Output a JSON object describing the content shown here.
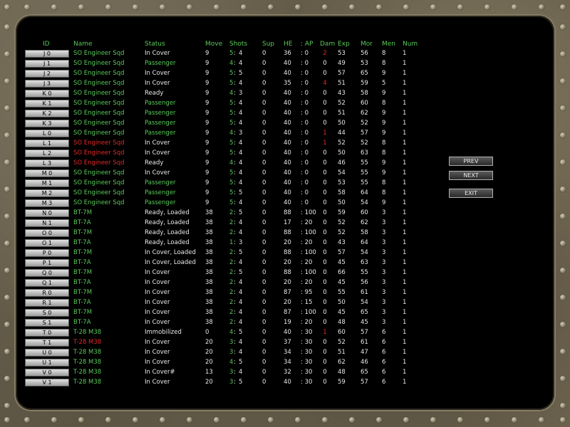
{
  "headers": {
    "id": "ID",
    "name": "Name",
    "status": "Status",
    "move": "Move",
    "shots": "Shots",
    "sup": "Sup",
    "he": "HE",
    "ap": ": AP",
    "dam": "Dam",
    "exp": "Exp",
    "mor": "Mor",
    "men": "Men",
    "num": "Num"
  },
  "buttons": {
    "prev": "PREV",
    "next": "NEXT",
    "exit": "EXIT"
  },
  "colors": {
    "green": "#59c959",
    "red": "#e02a2a",
    "white": "#e8e8e8"
  },
  "rows": [
    {
      "id": "J 0",
      "name": "SO Engineer Sqd",
      "nameColor": "green",
      "status": "In Cover",
      "statusColor": "white",
      "move": "9",
      "shotsA": "5",
      "shotsB": "4",
      "sup": "0",
      "he": "36",
      "ap": ": 0",
      "dam": "2",
      "damColor": "red",
      "exp": "53",
      "mor": "56",
      "men": "8",
      "num": "1"
    },
    {
      "id": "J 1",
      "name": "SO Engineer Sqd",
      "nameColor": "green",
      "status": "Passenger",
      "statusColor": "green",
      "move": "9",
      "shotsA": "4",
      "shotsB": "4",
      "sup": "0",
      "he": "40",
      "ap": ": 0",
      "dam": "0",
      "damColor": "white",
      "exp": "49",
      "mor": "53",
      "men": "8",
      "num": "1"
    },
    {
      "id": "J 2",
      "name": "SO Engineer Sqd",
      "nameColor": "green",
      "status": "In Cover",
      "statusColor": "white",
      "move": "9",
      "shotsA": "5",
      "shotsB": "5",
      "sup": "0",
      "he": "40",
      "ap": ": 0",
      "dam": "0",
      "damColor": "white",
      "exp": "57",
      "mor": "65",
      "men": "9",
      "num": "1"
    },
    {
      "id": "J 3",
      "name": "SO Engineer Sqd",
      "nameColor": "green",
      "status": "In Cover",
      "statusColor": "white",
      "move": "9",
      "shotsA": "5",
      "shotsB": "4",
      "sup": "0",
      "he": "35",
      "ap": ": 0",
      "dam": "4",
      "damColor": "red",
      "exp": "51",
      "mor": "59",
      "men": "5",
      "num": "1"
    },
    {
      "id": "K 0",
      "name": "SO Engineer Sqd",
      "nameColor": "green",
      "status": "Ready",
      "statusColor": "white",
      "move": "9",
      "shotsA": "4",
      "shotsB": "3",
      "sup": "0",
      "he": "40",
      "ap": ": 0",
      "dam": "0",
      "damColor": "white",
      "exp": "43",
      "mor": "58",
      "men": "9",
      "num": "1"
    },
    {
      "id": "K 1",
      "name": "SO Engineer Sqd",
      "nameColor": "green",
      "status": "Passenger",
      "statusColor": "green",
      "move": "9",
      "shotsA": "5",
      "shotsB": "4",
      "sup": "0",
      "he": "40",
      "ap": ": 0",
      "dam": "0",
      "damColor": "white",
      "exp": "52",
      "mor": "60",
      "men": "8",
      "num": "1"
    },
    {
      "id": "K 2",
      "name": "SO Engineer Sqd",
      "nameColor": "green",
      "status": "Passenger",
      "statusColor": "green",
      "move": "9",
      "shotsA": "5",
      "shotsB": "4",
      "sup": "0",
      "he": "40",
      "ap": ": 0",
      "dam": "0",
      "damColor": "white",
      "exp": "51",
      "mor": "62",
      "men": "9",
      "num": "1"
    },
    {
      "id": "K 3",
      "name": "SO Engineer Sqd",
      "nameColor": "green",
      "status": "Passenger",
      "statusColor": "green",
      "move": "9",
      "shotsA": "5",
      "shotsB": "4",
      "sup": "0",
      "he": "40",
      "ap": ": 0",
      "dam": "0",
      "damColor": "white",
      "exp": "50",
      "mor": "52",
      "men": "9",
      "num": "1"
    },
    {
      "id": "L 0",
      "name": "SO Engineer Sqd",
      "nameColor": "green",
      "status": "Passenger",
      "statusColor": "green",
      "move": "9",
      "shotsA": "4",
      "shotsB": "3",
      "sup": "0",
      "he": "40",
      "ap": ": 0",
      "dam": "1",
      "damColor": "red",
      "exp": "44",
      "mor": "57",
      "men": "9",
      "num": "1"
    },
    {
      "id": "L 1",
      "name": "SO Engineer Sqd",
      "nameColor": "red",
      "status": "In Cover",
      "statusColor": "white",
      "move": "9",
      "shotsA": "5",
      "shotsB": "4",
      "sup": "0",
      "he": "40",
      "ap": ": 0",
      "dam": "1",
      "damColor": "red",
      "exp": "52",
      "mor": "52",
      "men": "8",
      "num": "1"
    },
    {
      "id": "L 2",
      "name": "SO Engineer Sqd",
      "nameColor": "red",
      "status": "In Cover",
      "statusColor": "white",
      "move": "9",
      "shotsA": "5",
      "shotsB": "4",
      "sup": "0",
      "he": "40",
      "ap": ": 0",
      "dam": "0",
      "damColor": "white",
      "exp": "50",
      "mor": "63",
      "men": "8",
      "num": "1"
    },
    {
      "id": "L 3",
      "name": "SO Engineer Sqd",
      "nameColor": "red",
      "status": "Ready",
      "statusColor": "white",
      "move": "9",
      "shotsA": "4",
      "shotsB": "4",
      "sup": "0",
      "he": "40",
      "ap": ": 0",
      "dam": "0",
      "damColor": "white",
      "exp": "46",
      "mor": "55",
      "men": "9",
      "num": "1"
    },
    {
      "id": "M 0",
      "name": "SO Engineer Sqd",
      "nameColor": "green",
      "status": "In Cover",
      "statusColor": "white",
      "move": "9",
      "shotsA": "5",
      "shotsB": "4",
      "sup": "0",
      "he": "40",
      "ap": ": 0",
      "dam": "0",
      "damColor": "white",
      "exp": "54",
      "mor": "55",
      "men": "9",
      "num": "1"
    },
    {
      "id": "M 1",
      "name": "SO Engineer Sqd",
      "nameColor": "green",
      "status": "Passenger",
      "statusColor": "green",
      "move": "9",
      "shotsA": "5",
      "shotsB": "4",
      "sup": "0",
      "he": "40",
      "ap": ": 0",
      "dam": "0",
      "damColor": "white",
      "exp": "53",
      "mor": "55",
      "men": "8",
      "num": "1"
    },
    {
      "id": "M 2",
      "name": "SO Engineer Sqd",
      "nameColor": "green",
      "status": "Passenger",
      "statusColor": "green",
      "move": "9",
      "shotsA": "5",
      "shotsB": "5",
      "sup": "0",
      "he": "40",
      "ap": ": 0",
      "dam": "0",
      "damColor": "white",
      "exp": "58",
      "mor": "64",
      "men": "8",
      "num": "1"
    },
    {
      "id": "M 3",
      "name": "SO Engineer Sqd",
      "nameColor": "green",
      "status": "Passenger",
      "statusColor": "green",
      "move": "9",
      "shotsA": "5",
      "shotsB": "4",
      "sup": "0",
      "he": "40",
      "ap": ": 0",
      "dam": "0",
      "damColor": "white",
      "exp": "50",
      "mor": "54",
      "men": "9",
      "num": "1"
    },
    {
      "id": "N 0",
      "name": "BT-7M",
      "nameColor": "green",
      "status": "Ready,  Loaded",
      "statusColor": "white",
      "move": "38",
      "shotsA": "2",
      "shotsB": "5",
      "sup": "0",
      "he": "88",
      "ap": ": 100",
      "dam": "0",
      "damColor": "white",
      "exp": "59",
      "mor": "60",
      "men": "3",
      "num": "1"
    },
    {
      "id": "N 1",
      "name": "BT-7A",
      "nameColor": "green",
      "status": "Ready,  Loaded",
      "statusColor": "white",
      "move": "38",
      "shotsA": "2",
      "shotsB": "4",
      "sup": "0",
      "he": "17",
      "ap": ": 20",
      "dam": "0",
      "damColor": "white",
      "exp": "52",
      "mor": "62",
      "men": "3",
      "num": "1"
    },
    {
      "id": "O 0",
      "name": "BT-7M",
      "nameColor": "green",
      "status": "Ready,  Loaded",
      "statusColor": "white",
      "move": "38",
      "shotsA": "2",
      "shotsB": "4",
      "sup": "0",
      "he": "88",
      "ap": ": 100",
      "dam": "0",
      "damColor": "white",
      "exp": "52",
      "mor": "58",
      "men": "3",
      "num": "1"
    },
    {
      "id": "O 1",
      "name": "BT-7A",
      "nameColor": "green",
      "status": "Ready,  Loaded",
      "statusColor": "white",
      "move": "38",
      "shotsA": "1",
      "shotsB": "3",
      "sup": "0",
      "he": "20",
      "ap": ": 20",
      "dam": "0",
      "damColor": "white",
      "exp": "43",
      "mor": "64",
      "men": "3",
      "num": "1"
    },
    {
      "id": "P 0",
      "name": "BT-7M",
      "nameColor": "green",
      "status": "In Cover,  Loaded",
      "statusColor": "white",
      "move": "38",
      "shotsA": "2",
      "shotsB": "5",
      "sup": "0",
      "he": "88",
      "ap": ": 100",
      "dam": "0",
      "damColor": "white",
      "exp": "57",
      "mor": "54",
      "men": "3",
      "num": "1"
    },
    {
      "id": "P 1",
      "name": "BT-7A",
      "nameColor": "green",
      "status": "In Cover,  Loaded",
      "statusColor": "white",
      "move": "38",
      "shotsA": "2",
      "shotsB": "4",
      "sup": "0",
      "he": "20",
      "ap": ": 20",
      "dam": "0",
      "damColor": "white",
      "exp": "45",
      "mor": "63",
      "men": "3",
      "num": "1"
    },
    {
      "id": "Q 0",
      "name": "BT-7M",
      "nameColor": "green",
      "status": "In Cover",
      "statusColor": "white",
      "move": "38",
      "shotsA": "2",
      "shotsB": "5",
      "sup": "0",
      "he": "88",
      "ap": ": 100",
      "dam": "0",
      "damColor": "white",
      "exp": "66",
      "mor": "55",
      "men": "3",
      "num": "1"
    },
    {
      "id": "Q 1",
      "name": "BT-7A",
      "nameColor": "green",
      "status": "In Cover",
      "statusColor": "white",
      "move": "38",
      "shotsA": "2",
      "shotsB": "4",
      "sup": "0",
      "he": "20",
      "ap": ": 20",
      "dam": "0",
      "damColor": "white",
      "exp": "45",
      "mor": "56",
      "men": "3",
      "num": "1"
    },
    {
      "id": "R 0",
      "name": "BT-7M",
      "nameColor": "green",
      "status": "In Cover",
      "statusColor": "white",
      "move": "38",
      "shotsA": "2",
      "shotsB": "4",
      "sup": "0",
      "he": "87",
      "ap": ": 95",
      "dam": "0",
      "damColor": "white",
      "exp": "55",
      "mor": "61",
      "men": "3",
      "num": "1"
    },
    {
      "id": "R 1",
      "name": "BT-7A",
      "nameColor": "green",
      "status": "In Cover",
      "statusColor": "white",
      "move": "38",
      "shotsA": "2",
      "shotsB": "4",
      "sup": "0",
      "he": "20",
      "ap": ": 15",
      "dam": "0",
      "damColor": "white",
      "exp": "50",
      "mor": "54",
      "men": "3",
      "num": "1"
    },
    {
      "id": "S 0",
      "name": "BT-7M",
      "nameColor": "green",
      "status": "In Cover",
      "statusColor": "white",
      "move": "38",
      "shotsA": "2",
      "shotsB": "4",
      "sup": "0",
      "he": "87",
      "ap": ": 100",
      "dam": "0",
      "damColor": "white",
      "exp": "45",
      "mor": "65",
      "men": "3",
      "num": "1"
    },
    {
      "id": "S 1",
      "name": "BT-7A",
      "nameColor": "green",
      "status": "In Cover",
      "statusColor": "white",
      "move": "38",
      "shotsA": "2",
      "shotsB": "4",
      "sup": "0",
      "he": "19",
      "ap": ": 20",
      "dam": "0",
      "damColor": "white",
      "exp": "48",
      "mor": "45",
      "men": "3",
      "num": "1"
    },
    {
      "id": "T 0",
      "name": "T-28 M38",
      "nameColor": "green",
      "status": "Immobilized",
      "statusColor": "white",
      "move": "0",
      "shotsA": "4",
      "shotsB": "5",
      "sup": "0",
      "he": "40",
      "ap": ": 30",
      "dam": "1",
      "damColor": "red",
      "exp": "60",
      "mor": "57",
      "men": "6",
      "num": "1"
    },
    {
      "id": "T 1",
      "name": "T-28 M38",
      "nameColor": "red",
      "status": "In Cover",
      "statusColor": "white",
      "move": "20",
      "shotsA": "3",
      "shotsB": "4",
      "sup": "0",
      "he": "37",
      "ap": ": 30",
      "dam": "0",
      "damColor": "white",
      "exp": "52",
      "mor": "61",
      "men": "6",
      "num": "1"
    },
    {
      "id": "U 0",
      "name": "T-28 M38",
      "nameColor": "green",
      "status": "In Cover",
      "statusColor": "white",
      "move": "20",
      "shotsA": "3",
      "shotsB": "4",
      "sup": "0",
      "he": "34",
      "ap": ": 30",
      "dam": "0",
      "damColor": "white",
      "exp": "51",
      "mor": "47",
      "men": "6",
      "num": "1"
    },
    {
      "id": "U 1",
      "name": "T-28 M38",
      "nameColor": "green",
      "status": "In Cover",
      "statusColor": "white",
      "move": "20",
      "shotsA": "4",
      "shotsB": "5",
      "sup": "0",
      "he": "34",
      "ap": ": 30",
      "dam": "0",
      "damColor": "white",
      "exp": "62",
      "mor": "46",
      "men": "6",
      "num": "1"
    },
    {
      "id": "V 0",
      "name": "T-28 M38",
      "nameColor": "green",
      "status": "In Cover#",
      "statusColor": "white",
      "move": "13",
      "shotsA": "3",
      "shotsB": "4",
      "sup": "0",
      "he": "32",
      "ap": ": 30",
      "dam": "0",
      "damColor": "white",
      "exp": "48",
      "mor": "65",
      "men": "6",
      "num": "1"
    },
    {
      "id": "V 1",
      "name": "T-28 M38",
      "nameColor": "green",
      "status": "In Cover",
      "statusColor": "white",
      "move": "20",
      "shotsA": "3",
      "shotsB": "5",
      "sup": "0",
      "he": "40",
      "ap": ": 30",
      "dam": "0",
      "damColor": "white",
      "exp": "59",
      "mor": "57",
      "men": "6",
      "num": "1"
    }
  ]
}
